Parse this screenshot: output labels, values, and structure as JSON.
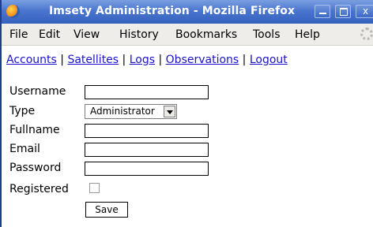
{
  "window": {
    "title": "Imsety Administration - Mozilla Firefox",
    "controls": {
      "minimize": "–",
      "maximize": "□",
      "close": "x"
    }
  },
  "menu": [
    {
      "label": "File"
    },
    {
      "label": "Edit"
    },
    {
      "label": "View"
    },
    {
      "label": "History"
    },
    {
      "label": "Bookmarks"
    },
    {
      "label": "Tools"
    },
    {
      "label": "Help"
    }
  ],
  "nav": {
    "links": [
      "Accounts",
      "Satellites",
      "Logs",
      "Observations",
      "Logout"
    ],
    "separator": "|"
  },
  "form": {
    "username": {
      "label": "Username",
      "value": ""
    },
    "type": {
      "label": "Type",
      "selected": "Administrator"
    },
    "fullname": {
      "label": "Fullname",
      "value": ""
    },
    "email": {
      "label": "Email",
      "value": ""
    },
    "password": {
      "label": "Password",
      "value": ""
    },
    "registered": {
      "label": "Registered",
      "checked": false
    },
    "save_label": "Save"
  },
  "colors": {
    "titlebar": "#3561bd",
    "link": "#1a14c6",
    "menubar": "#eeedea"
  }
}
